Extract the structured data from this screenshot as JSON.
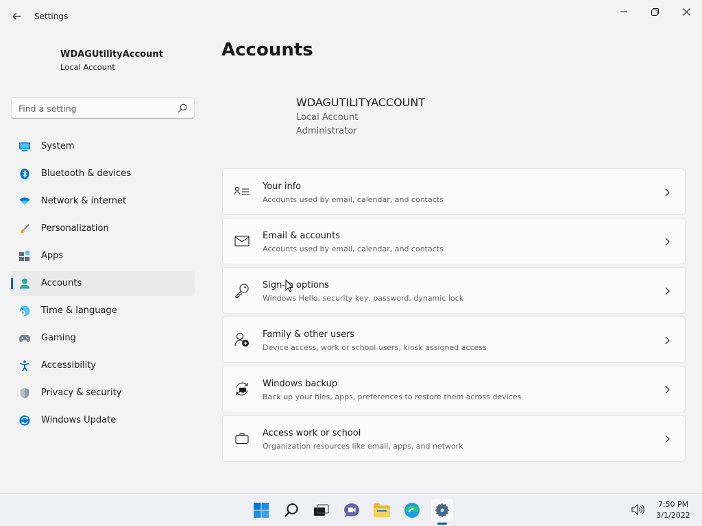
{
  "window": {
    "app_title": "Settings",
    "back_icon": "back-arrow-icon",
    "controls": [
      "minimize-icon",
      "restore-icon",
      "close-icon"
    ]
  },
  "profile": {
    "name": "WDAGUtilityAccount",
    "type": "Local Account"
  },
  "search": {
    "placeholder": "Find a setting"
  },
  "sidebar": {
    "items": [
      {
        "label": "System",
        "icon": "system-icon"
      },
      {
        "label": "Bluetooth & devices",
        "icon": "bluetooth-icon"
      },
      {
        "label": "Network & internet",
        "icon": "network-icon"
      },
      {
        "label": "Personalization",
        "icon": "personalization-icon"
      },
      {
        "label": "Apps",
        "icon": "apps-icon"
      },
      {
        "label": "Accounts",
        "icon": "accounts-icon",
        "selected": true
      },
      {
        "label": "Time & language",
        "icon": "time-language-icon"
      },
      {
        "label": "Gaming",
        "icon": "gaming-icon"
      },
      {
        "label": "Accessibility",
        "icon": "accessibility-icon"
      },
      {
        "label": "Privacy & security",
        "icon": "privacy-icon"
      },
      {
        "label": "Windows Update",
        "icon": "windows-update-icon"
      }
    ]
  },
  "main": {
    "title": "Accounts",
    "account": {
      "name": "WDAGUTILITYACCOUNT",
      "line1": "Local Account",
      "line2": "Administrator"
    },
    "cards": [
      {
        "title": "Your info",
        "subtitle": "Accounts used by email, calendar, and contacts",
        "icon": "person-card-icon"
      },
      {
        "title": "Email & accounts",
        "subtitle": "Accounts used by email, calendar, and contacts",
        "icon": "mail-icon"
      },
      {
        "title": "Sign-in options",
        "subtitle": "Windows Hello, security key, password, dynamic lock",
        "icon": "key-icon"
      },
      {
        "title": "Family & other users",
        "subtitle": "Device access, work or school users, kiosk assigned access",
        "icon": "add-person-icon"
      },
      {
        "title": "Windows backup",
        "subtitle": "Back up your files, apps, preferences to restore them across devices",
        "icon": "backup-icon"
      },
      {
        "title": "Access work or school",
        "subtitle": "Organization resources like email, apps, and network",
        "icon": "briefcase-icon"
      }
    ]
  },
  "taskbar": {
    "apps": [
      "start-icon",
      "search-icon",
      "task-view-icon",
      "chat-icon",
      "file-explorer-icon",
      "edge-icon",
      "settings-icon"
    ],
    "time": "7:50 PM",
    "date": "3/1/2022",
    "tray": [
      "volume-icon"
    ]
  },
  "colors": {
    "accent": "#005fb8",
    "background": "#f3f3f3",
    "card": "#fbfbfb"
  }
}
